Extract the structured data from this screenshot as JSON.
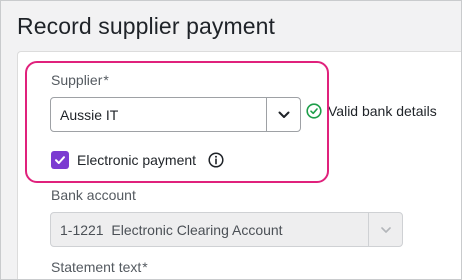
{
  "page": {
    "title": "Record supplier payment"
  },
  "supplier": {
    "label": "Supplier",
    "required_mark": "*",
    "selected_value": "Aussie IT",
    "validation_text": "Valid bank details"
  },
  "electronic_payment": {
    "label": "Electronic payment",
    "checked": true
  },
  "bank_account": {
    "label": "Bank account",
    "selected_value": "1-1221  Electronic Clearing Account",
    "disabled": true
  },
  "statement_text": {
    "label": "Statement text",
    "required_mark": "*"
  },
  "colors": {
    "highlight": "#e0217c",
    "checkbox": "#7b3bd1",
    "valid_icon": "#1e9e4a"
  },
  "icons": {
    "dropdown": "chevron-down-icon",
    "valid": "check-circle-icon",
    "info": "info-icon",
    "checkbox": "checkmark-icon"
  }
}
